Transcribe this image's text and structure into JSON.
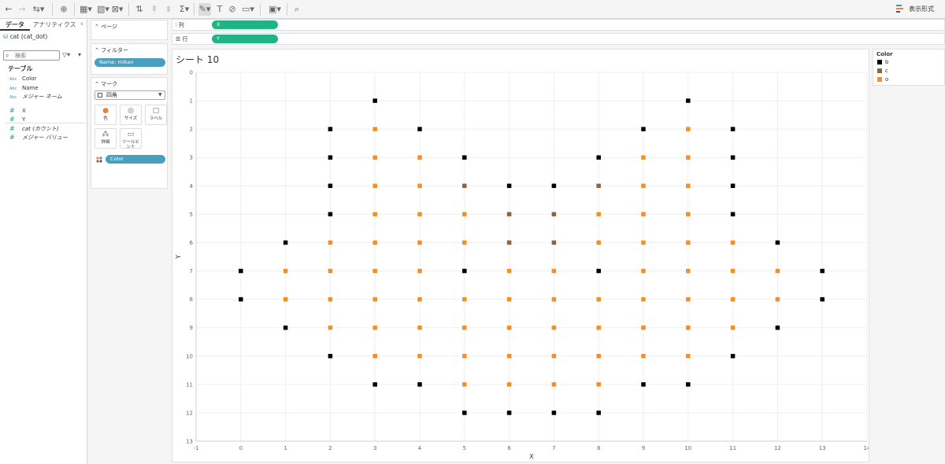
{
  "toolbar": {
    "icons": [
      "back-icon",
      "forward-icon",
      "undo-history-icon",
      "new-datasource-icon",
      "new-sheet-icon",
      "duplicate-sheet-icon",
      "swap-axes-icon",
      "sort-asc-icon",
      "sort-desc-icon",
      "totals-icon",
      "highlight-icon",
      "text-label-icon",
      "fit-icon",
      "fix-axes-icon",
      "presentation-icon",
      "tooltip-icon"
    ],
    "show_me": "表示形式"
  },
  "data_pane": {
    "tab_data": "データ",
    "tab_analytics": "アナリティクス",
    "datasource": "cat (cat_dot)",
    "search_placeholder": "検索",
    "tables_heading": "テーブル",
    "dimensions": [
      {
        "type": "Abc",
        "name": "Color"
      },
      {
        "type": "Abc",
        "name": "Name"
      },
      {
        "type": "Abc",
        "name": "メジャー ネーム"
      }
    ],
    "measures": [
      {
        "type": "#",
        "name": "X"
      },
      {
        "type": "#",
        "name": "Y"
      },
      {
        "type": "#",
        "name": "cat (カウント)"
      },
      {
        "type": "#",
        "name": "メジャー バリュー"
      }
    ]
  },
  "cards": {
    "pages_title": "ページ",
    "filters_title": "フィルター",
    "filter_pill": "Name: mikan",
    "marks_title": "マーク",
    "mark_type": "四角",
    "buttons": {
      "color": "色",
      "size": "サイズ",
      "label": "ラベル",
      "detail": "詳細",
      "tooltip": "ツールヒント"
    },
    "color_pill": "Color"
  },
  "shelves": {
    "columns_label": "列",
    "columns_pill": "X",
    "rows_label": "行",
    "rows_pill": "Y"
  },
  "sheet": {
    "title": "シート 10"
  },
  "legend": {
    "title": "Color",
    "items": [
      {
        "label": "b",
        "color": "#000000"
      },
      {
        "label": "c",
        "color": "#8a6741"
      },
      {
        "label": "o",
        "color": "#f0902d"
      }
    ]
  },
  "chart_data": {
    "type": "scatter",
    "xlabel": "X",
    "ylabel": "Y",
    "xlim": [
      -1,
      14
    ],
    "ylim": [
      0,
      13
    ],
    "y_reversed": true,
    "xticks": [
      -1,
      0,
      1,
      2,
      3,
      4,
      5,
      6,
      7,
      8,
      9,
      10,
      11,
      12,
      13,
      14
    ],
    "yticks": [
      0,
      1,
      2,
      3,
      4,
      5,
      6,
      7,
      8,
      9,
      10,
      11,
      12,
      13
    ],
    "grid": true,
    "marker": "square",
    "series": [
      {
        "name": "b",
        "color": "#000000",
        "points": [
          [
            3,
            1
          ],
          [
            10,
            1
          ],
          [
            2,
            2
          ],
          [
            4,
            2
          ],
          [
            9,
            2
          ],
          [
            11,
            2
          ],
          [
            2,
            3
          ],
          [
            5,
            3
          ],
          [
            8,
            3
          ],
          [
            11,
            3
          ],
          [
            2,
            4
          ],
          [
            6,
            4
          ],
          [
            7,
            4
          ],
          [
            11,
            4
          ],
          [
            2,
            5
          ],
          [
            11,
            5
          ],
          [
            1,
            6
          ],
          [
            12,
            6
          ],
          [
            0,
            7
          ],
          [
            5,
            7
          ],
          [
            8,
            7
          ],
          [
            13,
            7
          ],
          [
            0,
            8
          ],
          [
            13,
            8
          ],
          [
            1,
            9
          ],
          [
            12,
            9
          ],
          [
            2,
            10
          ],
          [
            11,
            10
          ],
          [
            3,
            11
          ],
          [
            4,
            11
          ],
          [
            9,
            11
          ],
          [
            10,
            11
          ],
          [
            5,
            12
          ],
          [
            6,
            12
          ],
          [
            7,
            12
          ],
          [
            8,
            12
          ]
        ]
      },
      {
        "name": "c",
        "color": "#8a6741",
        "points": [
          [
            5,
            4
          ],
          [
            8,
            4
          ],
          [
            6,
            5
          ],
          [
            7,
            5
          ],
          [
            6,
            6
          ],
          [
            7,
            6
          ]
        ]
      },
      {
        "name": "o",
        "color": "#f0902d",
        "points": [
          [
            3,
            2
          ],
          [
            10,
            2
          ],
          [
            3,
            3
          ],
          [
            4,
            3
          ],
          [
            9,
            3
          ],
          [
            10,
            3
          ],
          [
            3,
            4
          ],
          [
            4,
            4
          ],
          [
            9,
            4
          ],
          [
            10,
            4
          ],
          [
            3,
            5
          ],
          [
            4,
            5
          ],
          [
            5,
            5
          ],
          [
            8,
            5
          ],
          [
            9,
            5
          ],
          [
            10,
            5
          ],
          [
            2,
            6
          ],
          [
            3,
            6
          ],
          [
            4,
            6
          ],
          [
            5,
            6
          ],
          [
            8,
            6
          ],
          [
            9,
            6
          ],
          [
            10,
            6
          ],
          [
            11,
            6
          ],
          [
            1,
            7
          ],
          [
            2,
            7
          ],
          [
            3,
            7
          ],
          [
            4,
            7
          ],
          [
            6,
            7
          ],
          [
            7,
            7
          ],
          [
            9,
            7
          ],
          [
            10,
            7
          ],
          [
            11,
            7
          ],
          [
            12,
            7
          ],
          [
            1,
            8
          ],
          [
            2,
            8
          ],
          [
            3,
            8
          ],
          [
            4,
            8
          ],
          [
            5,
            8
          ],
          [
            6,
            8
          ],
          [
            7,
            8
          ],
          [
            8,
            8
          ],
          [
            9,
            8
          ],
          [
            10,
            8
          ],
          [
            11,
            8
          ],
          [
            12,
            8
          ],
          [
            2,
            9
          ],
          [
            3,
            9
          ],
          [
            4,
            9
          ],
          [
            5,
            9
          ],
          [
            6,
            9
          ],
          [
            7,
            9
          ],
          [
            8,
            9
          ],
          [
            9,
            9
          ],
          [
            10,
            9
          ],
          [
            11,
            9
          ],
          [
            3,
            10
          ],
          [
            4,
            10
          ],
          [
            5,
            10
          ],
          [
            6,
            10
          ],
          [
            7,
            10
          ],
          [
            8,
            10
          ],
          [
            9,
            10
          ],
          [
            10,
            10
          ],
          [
            5,
            11
          ],
          [
            6,
            11
          ],
          [
            7,
            11
          ],
          [
            8,
            11
          ]
        ]
      }
    ]
  }
}
